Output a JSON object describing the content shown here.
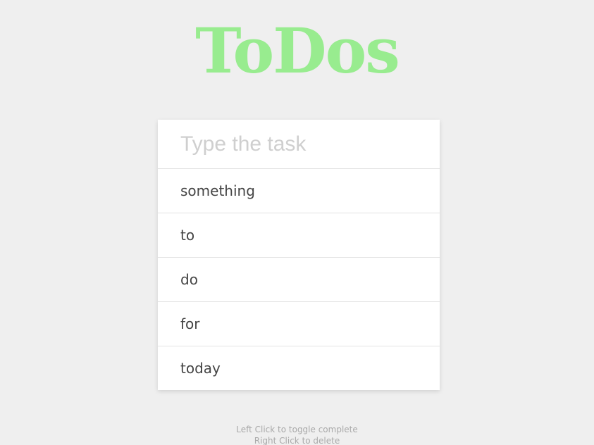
{
  "app": {
    "title": "ToDos"
  },
  "input": {
    "placeholder": "Type the task",
    "value": ""
  },
  "tasks": [
    {
      "label": "something"
    },
    {
      "label": "to"
    },
    {
      "label": "do"
    },
    {
      "label": "for"
    },
    {
      "label": "today"
    }
  ],
  "instructions": {
    "left_click": "Left Click to toggle complete",
    "right_click": "Right Click to delete"
  },
  "colors": {
    "background": "#efefef",
    "title": "#98ec8f",
    "card": "#ffffff",
    "task_text": "#444444",
    "placeholder": "#cfcfcf",
    "hint_text": "#a9a9a9"
  }
}
